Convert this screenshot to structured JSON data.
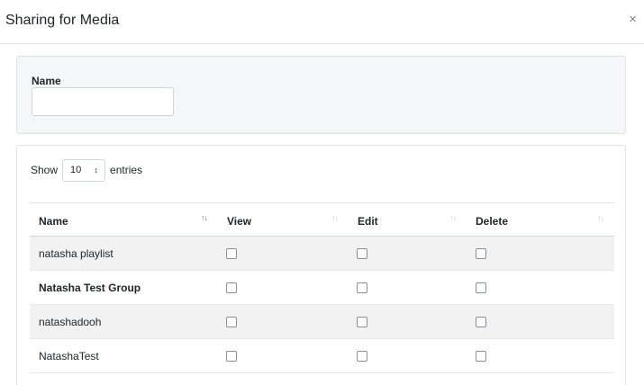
{
  "modal": {
    "title": "Sharing for Media",
    "close_glyph": "×"
  },
  "filter": {
    "name_label": "Name",
    "name_value": "",
    "name_placeholder": ""
  },
  "table": {
    "show_label": "Show",
    "page_length": "10",
    "entries_label": "entries",
    "columns": [
      {
        "label": "Name",
        "sort_icon": "sort-icon",
        "sort_state": "active"
      },
      {
        "label": "View",
        "sort_icon": "sort-icon",
        "sort_state": "inactive"
      },
      {
        "label": "Edit",
        "sort_icon": "sort-icon",
        "sort_state": "inactive"
      },
      {
        "label": "Delete",
        "sort_icon": "sort-icon",
        "sort_state": "inactive"
      }
    ],
    "rows": [
      {
        "name": "natasha playlist",
        "bold": false,
        "view": false,
        "edit": false,
        "delete": false
      },
      {
        "name": "Natasha Test Group",
        "bold": true,
        "view": false,
        "edit": false,
        "delete": false
      },
      {
        "name": "natashadooh",
        "bold": false,
        "view": false,
        "edit": false,
        "delete": false
      },
      {
        "name": "NatashaTest",
        "bold": false,
        "view": false,
        "edit": false,
        "delete": false
      }
    ]
  }
}
